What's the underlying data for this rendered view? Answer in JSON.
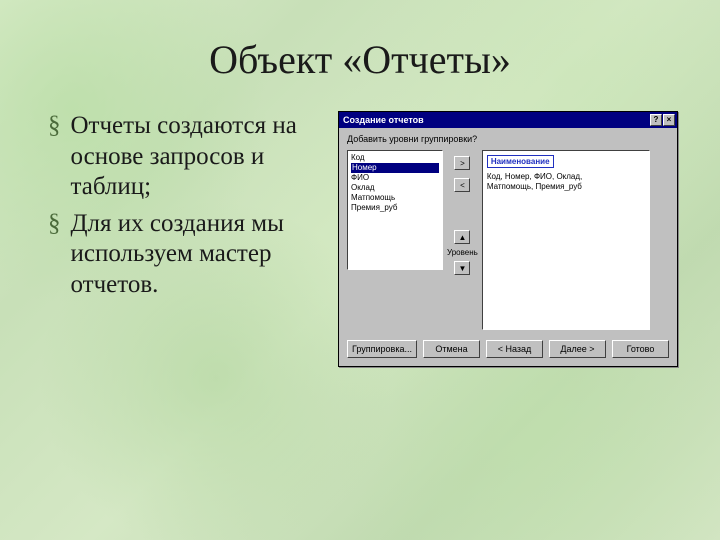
{
  "slide": {
    "title": "Объект «Отчеты»",
    "bullets": [
      "Отчеты создаются на основе запросов и таблиц;",
      "Для их создания мы используем мастер отчетов."
    ]
  },
  "dialog": {
    "title": "Создание отчетов",
    "close_glyph": "×",
    "help_glyph": "?",
    "prompt": "Добавить уровни группировки?",
    "available_fields": {
      "items": [
        "Код",
        "Номер",
        "ФИО",
        "Оклад",
        "Матпомощь",
        "Премия_руб"
      ],
      "selected_index": 1
    },
    "move_buttons": {
      "add": ">",
      "remove": "<"
    },
    "priority": {
      "label": "Уровень",
      "up": "▲",
      "down": "▼"
    },
    "preview": {
      "header": "Наименование",
      "line1": "Код, Номер, ФИО, Оклад,",
      "line2": "Матпомощь, Премия_руб"
    },
    "buttons": {
      "grouping": "Группировка...",
      "cancel": "Отмена",
      "back": "< Назад",
      "next": "Далее >",
      "finish": "Готово"
    }
  }
}
